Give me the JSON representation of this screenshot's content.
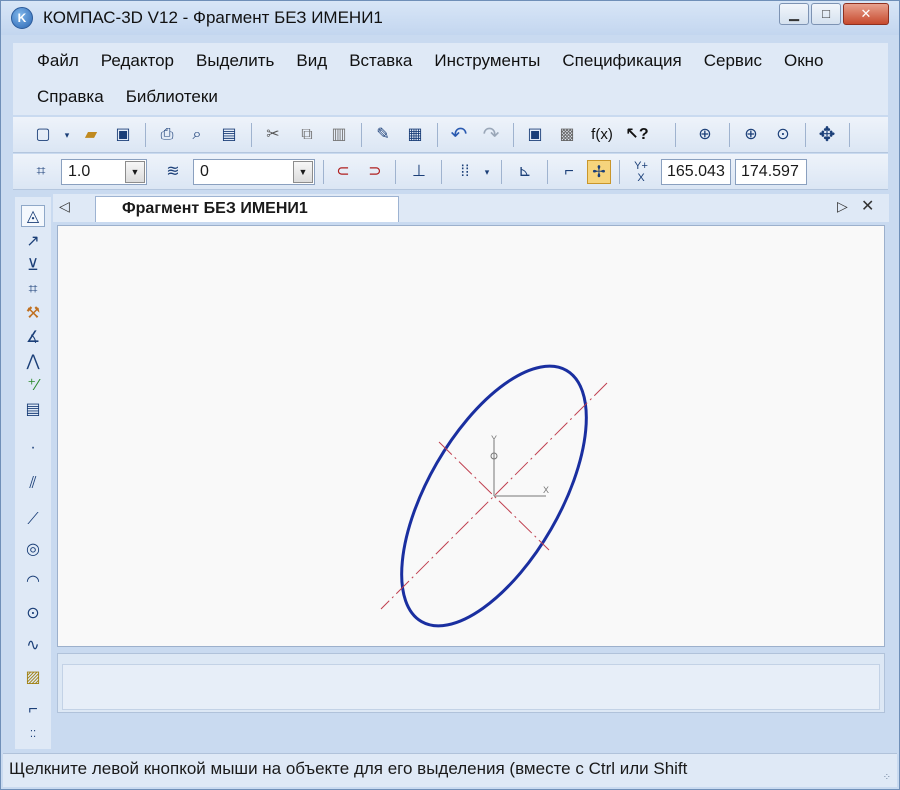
{
  "window": {
    "title": "КОМПАС-3D V12 - Фрагмент БЕЗ ИМЕНИ1",
    "minimize": "▁",
    "maximize": "□",
    "close": "✕"
  },
  "menu": {
    "row1": [
      "Файл",
      "Редактор",
      "Выделить",
      "Вид",
      "Вставка",
      "Инструменты",
      "Спецификация",
      "Сервис",
      "Окно"
    ],
    "row2": [
      "Справка",
      "Библиотеки"
    ]
  },
  "toolbar2": {
    "scale_value": "1.0",
    "layer_value": "0",
    "coord_x": "165.043",
    "coord_y": "174.597"
  },
  "document": {
    "tab_label": "Фрагмент БЕЗ ИМЕНИ1",
    "tab_prev": "◁",
    "tab_next": "▷",
    "tab_close": "✕"
  },
  "status": {
    "hint": "Щелкните левой кнопкой мыши на объекте для его выделения (вместе с Ctrl или Shift"
  },
  "colors": {
    "ellipse": "#1a2fa0",
    "axis_lines": "#c04050",
    "origin": "#808080"
  }
}
